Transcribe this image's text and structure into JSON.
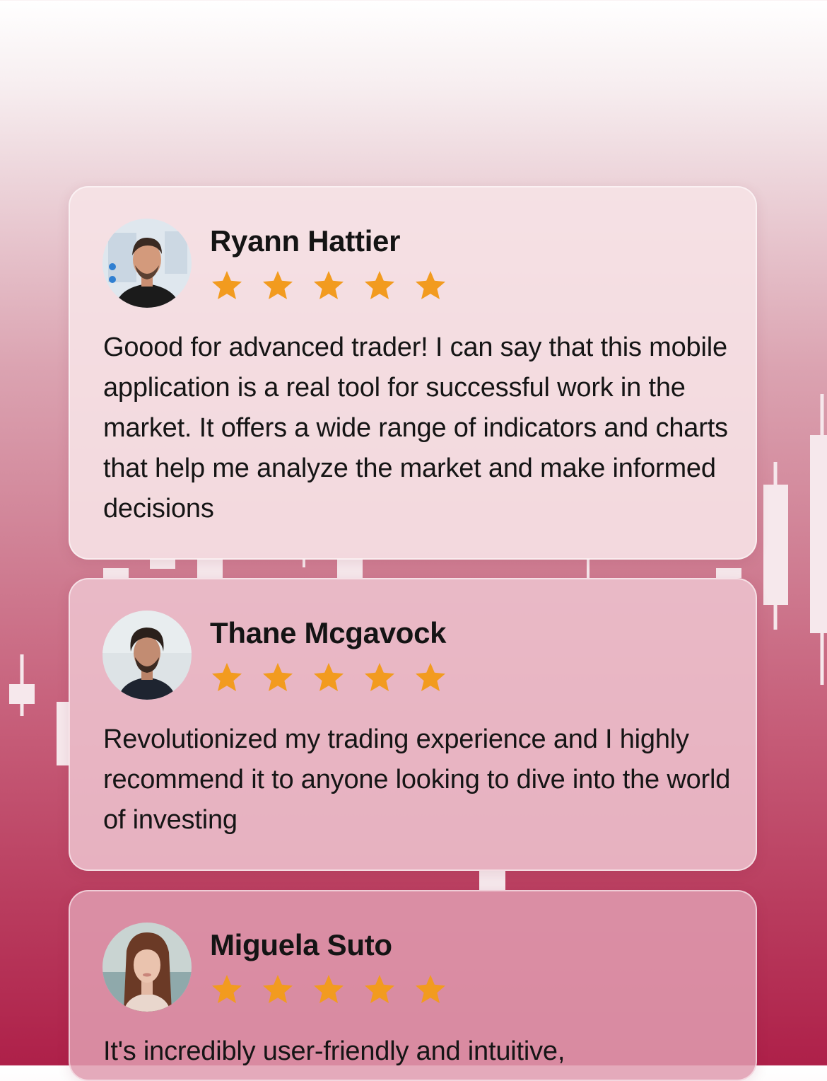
{
  "colors": {
    "star": "#f29b1f",
    "text": "#151515",
    "background_top": "#ffffff",
    "background_bottom": "#ae2049"
  },
  "reviews": [
    {
      "name": "Ryann Hattier",
      "rating": 5,
      "avatar_icon": "avatar-photo",
      "text": "Goood for advanced trader! I can say that this mobile application is a real tool for successful work in the market. It offers a wide range of indicators and charts that help me analyze the market and make informed decisions"
    },
    {
      "name": "Thane Mcgavock",
      "rating": 5,
      "avatar_icon": "avatar-photo",
      "text": "Revolutionized my trading experience and I highly recommend it to anyone looking to dive into the world of investing"
    },
    {
      "name": "Miguela Suto",
      "rating": 5,
      "avatar_icon": "avatar-photo",
      "text": "It's incredibly user-friendly and intuitive,"
    }
  ]
}
